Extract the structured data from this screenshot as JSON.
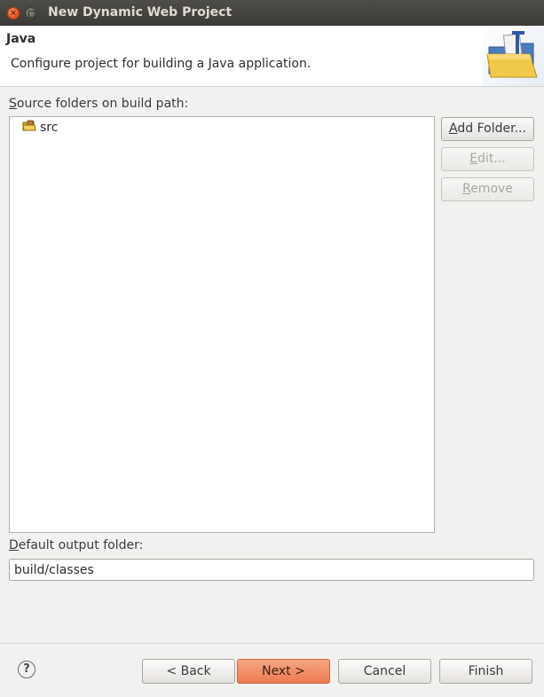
{
  "window": {
    "title": "New Dynamic Web Project"
  },
  "header": {
    "title": "Java",
    "description": "Configure project for building a Java application."
  },
  "source_folders": {
    "label_mnemonic": "S",
    "label_rest": "ource folders on build path:",
    "items": [
      {
        "label": "src",
        "icon": "package-folder-icon"
      }
    ]
  },
  "side_buttons": {
    "add_folder_mnemonic": "A",
    "add_folder_rest": "dd Folder...",
    "edit_mnemonic": "E",
    "edit_rest": "dit...",
    "remove_mnemonic": "R",
    "remove_rest": "emove"
  },
  "output": {
    "label_mnemonic": "D",
    "label_rest": "efault output folder:",
    "value": "build/classes"
  },
  "footer": {
    "help": "?",
    "back": "< Back",
    "next": "Next >",
    "cancel": "Cancel",
    "finish": "Finish"
  },
  "colors": {
    "primary_button": "#ec7a4f",
    "title_bar": "#3b3a36",
    "close_button": "#e2501f"
  }
}
